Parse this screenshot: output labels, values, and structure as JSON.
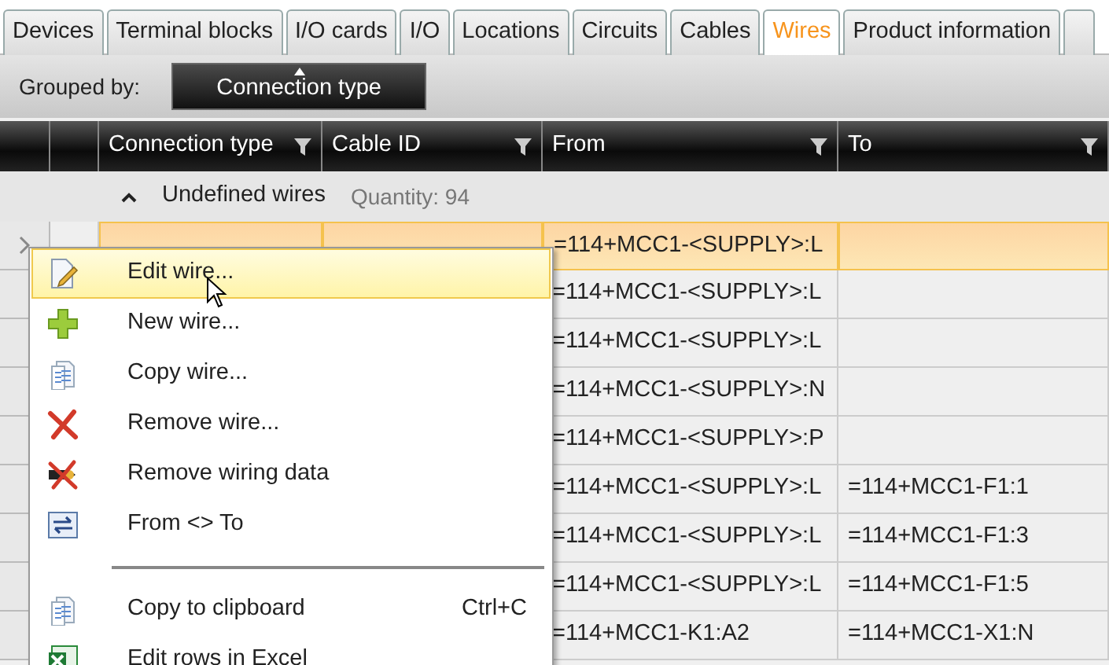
{
  "tabs": [
    {
      "label": "Devices",
      "selected": false
    },
    {
      "label": "Terminal blocks",
      "selected": false
    },
    {
      "label": "I/O cards",
      "selected": false
    },
    {
      "label": "I/O",
      "selected": false
    },
    {
      "label": "Locations",
      "selected": false
    },
    {
      "label": "Circuits",
      "selected": false
    },
    {
      "label": "Cables",
      "selected": false
    },
    {
      "label": "Wires",
      "selected": true
    },
    {
      "label": "Product information",
      "selected": false
    }
  ],
  "toolbar": {
    "label": "Grouped by:",
    "group_button": "Connection type"
  },
  "table": {
    "columns": [
      {
        "label": "Connection type"
      },
      {
        "label": "Cable ID"
      },
      {
        "label": "From"
      },
      {
        "label": "To"
      }
    ],
    "group": {
      "expanded": true,
      "label": "Undefined wires",
      "count": "Quantity: 94"
    },
    "rows": [
      {
        "selected": true,
        "from": "=114+MCC1-<SUPPLY>:L"
      },
      {
        "selected": false,
        "from": "=114+MCC1-<SUPPLY>:L"
      },
      {
        "selected": false,
        "from": "=114+MCC1-<SUPPLY>:L"
      },
      {
        "selected": false,
        "from": "=114+MCC1-<SUPPLY>:N"
      },
      {
        "selected": false,
        "from": "=114+MCC1-<SUPPLY>:P"
      },
      {
        "selected": false,
        "from": "=114+MCC1-<SUPPLY>:L",
        "to": "=114+MCC1-F1:1"
      },
      {
        "selected": false,
        "from": "=114+MCC1-<SUPPLY>:L",
        "to": "=114+MCC1-F1:3"
      },
      {
        "selected": false,
        "from": "=114+MCC1-<SUPPLY>:L",
        "to": "=114+MCC1-F1:5"
      },
      {
        "selected": false,
        "from": "=114+MCC1-K1:A2",
        "to": "=114+MCC1-X1:N"
      }
    ]
  },
  "context_menu": {
    "items": [
      {
        "kind": "item",
        "label": "Edit wire...",
        "highlighted": true
      },
      {
        "kind": "item",
        "label": "New wire...",
        "highlighted": false
      },
      {
        "kind": "item",
        "label": "Copy wire...",
        "highlighted": false
      },
      {
        "kind": "item",
        "label": "Remove wire...",
        "highlighted": false
      },
      {
        "kind": "item",
        "label": "Remove wiring data",
        "highlighted": false
      },
      {
        "kind": "item",
        "label": "From <> To",
        "highlighted": false
      },
      {
        "kind": "separator"
      },
      {
        "kind": "item",
        "label": "Copy to clipboard",
        "shortcut": "Ctrl+C",
        "highlighted": false
      },
      {
        "kind": "item",
        "label": "Edit rows in Excel",
        "highlighted": false
      }
    ]
  }
}
